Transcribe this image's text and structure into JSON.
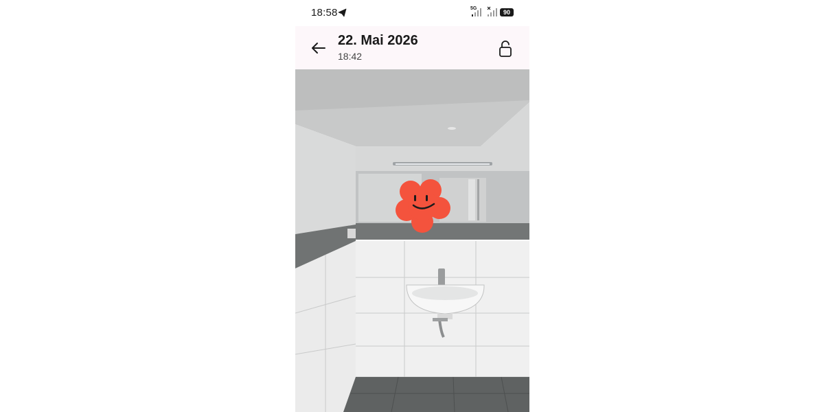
{
  "status_bar": {
    "time": "18:58",
    "telegram_icon": "telegram-icon",
    "network_label": "5G",
    "battery": "90"
  },
  "header": {
    "back_icon": "arrow-left-icon",
    "date": "22. Mai 2026",
    "time": "18:42",
    "lock_icon": "lock-open-icon"
  },
  "photo": {
    "subject": "bathroom-photo",
    "sticker_icon": "smiley-flower-icon"
  }
}
